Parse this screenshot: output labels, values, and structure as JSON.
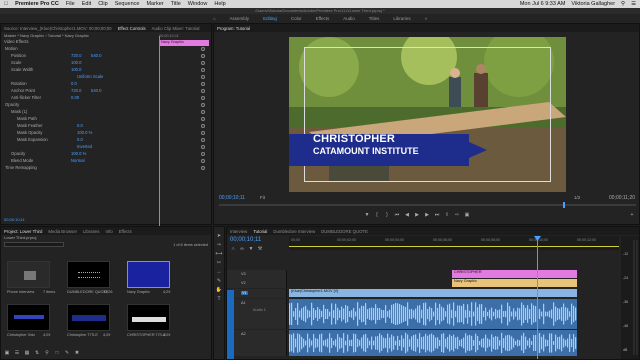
{
  "menubar": {
    "app": "Premiere Pro CC",
    "items": [
      "File",
      "Edit",
      "Clip",
      "Sequence",
      "Marker",
      "Title",
      "Window",
      "Help"
    ],
    "right": "Mon Jul 6  9:33 AM",
    "user": "Viktoria Gallagher"
  },
  "window_title": "/Users/Viktoria/Documents/Adobe/Premiere Pro/11.0/Lower Third.prproj *",
  "workspaces": [
    "Assembly",
    "Editing",
    "Color",
    "Effects",
    "Audio",
    "Titles",
    "Libraries"
  ],
  "workspace_active": "Editing",
  "effects_panel": {
    "tabs": [
      "Source: Interview_(Klue)Christopher1.MOV: 00;00;00;00",
      "Effect Controls",
      "Audio Clip Mixer: Tutorial"
    ],
    "active_tab": "Effect Controls",
    "breadcrumb": "Master * Navy Graphic  ›  Tutorial * Navy Graphic",
    "mini_timecode": "00;00;10;11",
    "clip_label": "Navy Graphic",
    "section": "Video Effects",
    "properties": [
      {
        "name": "Motion",
        "v1": "",
        "v2": "",
        "indent": 0
      },
      {
        "name": "Position",
        "v1": "720.0",
        "v2": "540.0",
        "indent": 1
      },
      {
        "name": "Scale",
        "v1": "100.0",
        "v2": "",
        "indent": 1
      },
      {
        "name": "Scale Width",
        "v1": "100.0",
        "v2": "",
        "indent": 1
      },
      {
        "name": "",
        "v1": "Uniform Scale",
        "v2": "",
        "indent": 2
      },
      {
        "name": "Rotation",
        "v1": "0.0",
        "v2": "",
        "indent": 1
      },
      {
        "name": "Anchor Point",
        "v1": "720.0",
        "v2": "540.0",
        "indent": 1
      },
      {
        "name": "Anti-flicker Filter",
        "v1": "0.00",
        "v2": "",
        "indent": 1
      },
      {
        "name": "Opacity",
        "v1": "",
        "v2": "",
        "indent": 0
      },
      {
        "name": "Mask (1)",
        "v1": "",
        "v2": "",
        "indent": 1
      },
      {
        "name": "Mask Path",
        "v1": "",
        "v2": "",
        "indent": 2
      },
      {
        "name": "Mask Feather",
        "v1": "0.0",
        "v2": "",
        "indent": 2
      },
      {
        "name": "Mask Opacity",
        "v1": "100.0 %",
        "v2": "",
        "indent": 2
      },
      {
        "name": "Mask Expansion",
        "v1": "0.0",
        "v2": "",
        "indent": 2
      },
      {
        "name": "",
        "v1": "Inverted",
        "v2": "",
        "indent": 2
      },
      {
        "name": "Opacity",
        "v1": "100.0 %",
        "v2": "",
        "indent": 1
      },
      {
        "name": "Blend Mode",
        "v1": "Normal",
        "v2": "",
        "indent": 1
      },
      {
        "name": "Time Remapping",
        "v1": "",
        "v2": "",
        "indent": 0
      }
    ],
    "timecode": "00;00;10;11"
  },
  "program_monitor": {
    "title": "Program: Tutorial",
    "lower_third_line1": "CHRISTOPHER",
    "lower_third_line2": "CATAMOUNT INSTITUTE",
    "timecode": "00;00;10;11",
    "fit": "Fit",
    "fraction": "1/2",
    "duration": "00;00;11;20"
  },
  "project_panel": {
    "tabs": [
      "Project: Lower Third",
      "Media Browser",
      "Libraries",
      "Info",
      "Effects"
    ],
    "file": "Lower Third.prproj",
    "search_placeholder": "",
    "selection_info": "1 of 8 items selected",
    "items": [
      {
        "name": "Phone Interview",
        "count": "7 items",
        "kind": "folder"
      },
      {
        "name": "DUMBLEDORE QUOTE",
        "count": "12;26",
        "kind": "text"
      },
      {
        "name": "Navy Graphic",
        "count": "4;29",
        "kind": "navy"
      },
      {
        "name": "Christopher Vidz",
        "count": "4;29",
        "kind": "text2"
      },
      {
        "name": "Christopher TITLE",
        "count": "4;29",
        "kind": "text3"
      },
      {
        "name": "CHRISTOPHER TITLE",
        "count": "4;29",
        "kind": "text4"
      }
    ]
  },
  "timeline": {
    "tabs": [
      "Interview",
      "Tutorial",
      "Dumbledore Interview",
      "DUMBLEDORE QUOTE"
    ],
    "active_tab": "Tutorial",
    "timecode": "00;00;10;11",
    "ruler": [
      "00;00",
      "00;00;02;00",
      "00;00;04;00",
      "00;00;06;00",
      "00;00;08;00",
      "00;00;10;00",
      "00;00;12;00"
    ],
    "tracks": [
      "V3",
      "V2",
      "V1",
      "A1",
      "A2"
    ],
    "clips": [
      {
        "name": "CHRISTOPHER",
        "track": "V3",
        "color": "#e37adf"
      },
      {
        "name": "Navy Graphic",
        "track": "V2",
        "color": "#e8c47a"
      },
      {
        "name": "(Klue)Christopher1.MOV [V]",
        "track": "V1",
        "color": "#88b6e0"
      },
      {
        "name": "Audio 1",
        "track": "A1",
        "color": "#5b8fc2"
      }
    ],
    "db_labels": [
      "-12",
      "-24",
      "-36",
      "-48",
      "dB"
    ]
  },
  "colors": {
    "accent": "#4aa0ff",
    "bg": "#232323",
    "navy": "#1e2d8c",
    "pink": "#e37adf",
    "yellow": "#e8c47a",
    "audio": "#5b8fc2"
  }
}
